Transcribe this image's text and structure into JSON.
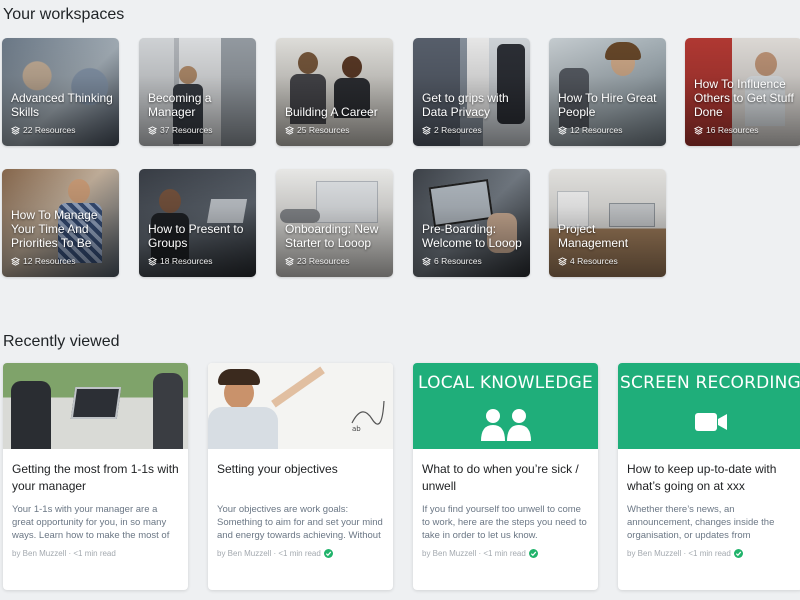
{
  "workspaces": {
    "title": "Your workspaces",
    "items": [
      {
        "name": "Advanced Thinking Skills",
        "resources": "22 Resources"
      },
      {
        "name": "Becoming a Manager",
        "resources": "37 Resources"
      },
      {
        "name": "Building A Career",
        "resources": "25 Resources"
      },
      {
        "name": "Get to grips with Data Privacy",
        "resources": "2 Resources"
      },
      {
        "name": "How To Hire Great People",
        "resources": "12 Resources"
      },
      {
        "name": "How To Influence Others to Get Stuff Done",
        "resources": "16 Resources"
      },
      {
        "name": "How To Manage Your Time And Priorities To Be",
        "resources": "12 Resources"
      },
      {
        "name": "How to Present to Groups",
        "resources": "18 Resources"
      },
      {
        "name": "Onboarding: New Starter to Looop",
        "resources": "23 Resources"
      },
      {
        "name": "Pre-Boarding: Welcome to Looop",
        "resources": "6 Resources"
      },
      {
        "name": "Project Management",
        "resources": "4 Resources"
      }
    ]
  },
  "recent": {
    "title": "Recently viewed",
    "items": [
      {
        "title": "Getting the most from 1-1s with your manager",
        "desc": "Your 1-1s with your manager are a great opportunity for you, in so many ways. Learn how to make the most of",
        "meta": "by Ben Muzzell · <1 min read",
        "checked": false
      },
      {
        "title": "Setting your objectives",
        "desc": "Your objectives are work goals: Something to aim for and set your mind and energy towards achieving. Without",
        "meta": "by Ben Muzzell · <1 min read",
        "checked": true
      },
      {
        "title": "What to do when you’re sick / unwell",
        "desc": "If you find yourself too unwell to come to work, here are the steps you need to take in order to let us know.",
        "meta": "by Ben Muzzell · <1 min read",
        "checked": true,
        "banner": "LOCAL KNOWLEDGE"
      },
      {
        "title": "How to keep up-to-date with what’s going on at xxx",
        "desc": "Whether there’s news, an announcement, changes inside the organisation, or updates from",
        "meta": "by Ben Muzzell · <1 min read",
        "checked": true,
        "banner": "SCREEN RECORDING"
      }
    ]
  },
  "colors": {
    "accent_green": "#1fae7a",
    "check_green": "#21b36b",
    "page_bg": "#eef0f2"
  },
  "icons": {
    "resource": "stack-icon",
    "read": "check-icon",
    "people": "people-icon",
    "video": "video-camera-icon"
  }
}
